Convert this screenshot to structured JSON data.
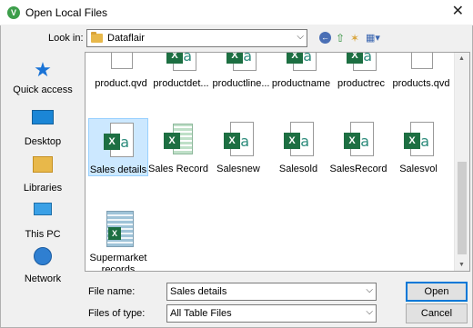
{
  "window": {
    "title": "Open Local Files",
    "app_icon": "V"
  },
  "toolbar": {
    "look_in_label": "Look in:",
    "look_in_value": "Dataflair",
    "back_icon": "back-icon",
    "up_icon": "up-folder-icon",
    "new_folder_icon": "new-folder-icon",
    "view_icon": "view-menu-icon"
  },
  "places": [
    {
      "label": "Quick access",
      "icon": "star-icon"
    },
    {
      "label": "Desktop",
      "icon": "desktop-icon"
    },
    {
      "label": "Libraries",
      "icon": "libraries-icon"
    },
    {
      "label": "This PC",
      "icon": "computer-icon"
    },
    {
      "label": "Network",
      "icon": "network-icon"
    }
  ],
  "files_row1": [
    "product.qvd",
    "productdet...",
    "productline...",
    "productname",
    "productrec",
    "products.qvd"
  ],
  "files_row2": [
    "Sales details",
    "Sales Record",
    "Salesnew",
    "Salesold",
    "SalesRecord",
    "Salesvol"
  ],
  "files_row3": [
    "Supermarket records"
  ],
  "file_name": {
    "label": "File name:",
    "value": "Sales details"
  },
  "file_type": {
    "label": "Files of type:",
    "value": "All Table Files"
  },
  "buttons": {
    "open": "Open",
    "cancel": "Cancel"
  },
  "colors": {
    "selection": "#cce8ff",
    "accent": "#0078d7",
    "excel_green": "#1d6f42"
  }
}
